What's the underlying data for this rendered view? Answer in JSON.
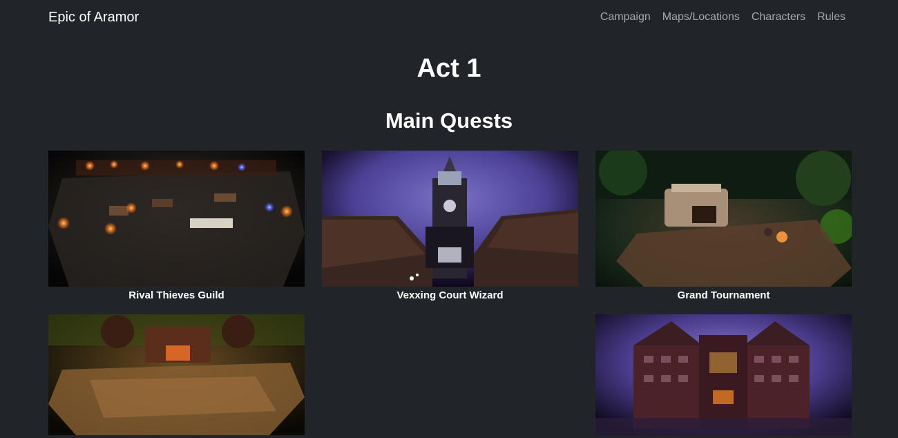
{
  "navbar": {
    "brand": "Epic of Aramor",
    "links": [
      "Campaign",
      "Maps/Locations",
      "Characters",
      "Rules"
    ]
  },
  "page": {
    "title": "Act 1",
    "section": "Main Quests"
  },
  "quests": [
    {
      "caption": "Rival Thieves Guild"
    },
    {
      "caption": "Vexxing Court Wizard"
    },
    {
      "caption": "Grand Tournament"
    },
    {
      "caption": ""
    },
    {
      "caption": ""
    }
  ]
}
